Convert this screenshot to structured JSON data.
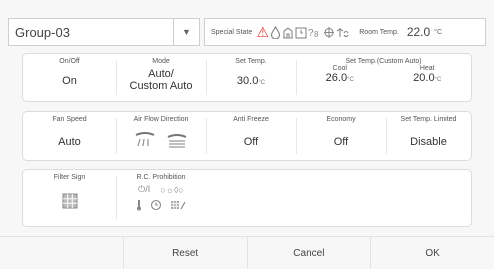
{
  "header": {
    "group_name": "Group-03",
    "dropdown_glyph": "▼",
    "special_state_label": "Special State",
    "special_state_icons": [
      "warning-icon",
      "droplet-icon",
      "building-icon",
      "schedule-icon",
      "energy-save-icon",
      "compass-icon",
      "fan-defrost-icon"
    ],
    "room_temp_label": "Room Temp.",
    "room_temp_value": "22.0",
    "room_temp_unit": "°C"
  },
  "row1": {
    "onoff": {
      "label": "On/Off",
      "value": "On"
    },
    "mode": {
      "label": "Mode",
      "value_line1": "Auto/",
      "value_line2": "Custom Auto"
    },
    "set_temp": {
      "label": "Set Temp.",
      "value": "30.0",
      "unit": "°C"
    },
    "set_temp_custom": {
      "label": "Set Temp.(Custom Auto)",
      "cool_label": "Cool",
      "cool_value": "26.0",
      "cool_unit": "°C",
      "heat_label": "Heat",
      "heat_value": "20.0",
      "heat_unit": "°C"
    }
  },
  "row2": {
    "fan_speed": {
      "label": "Fan Speed",
      "value": "Auto"
    },
    "air_flow": {
      "label": "Air Flow Direction"
    },
    "anti_freeze": {
      "label": "Anti Freeze",
      "value": "Off"
    },
    "economy": {
      "label": "Economy",
      "value": "Off"
    },
    "set_temp_limited": {
      "label": "Set Temp. Limited",
      "value": "Disable"
    }
  },
  "row3": {
    "filter_sign": {
      "label": "Filter Sign"
    },
    "rc_prohibition": {
      "label": "R.C. Prohibition",
      "icon_onoff": "⏻/I",
      "icon_mode": "○☼◊○"
    }
  },
  "footer": {
    "reset": "Reset",
    "cancel": "Cancel",
    "ok": "OK"
  },
  "colors": {
    "warning": "#e53935",
    "icon_gray": "#888888"
  }
}
